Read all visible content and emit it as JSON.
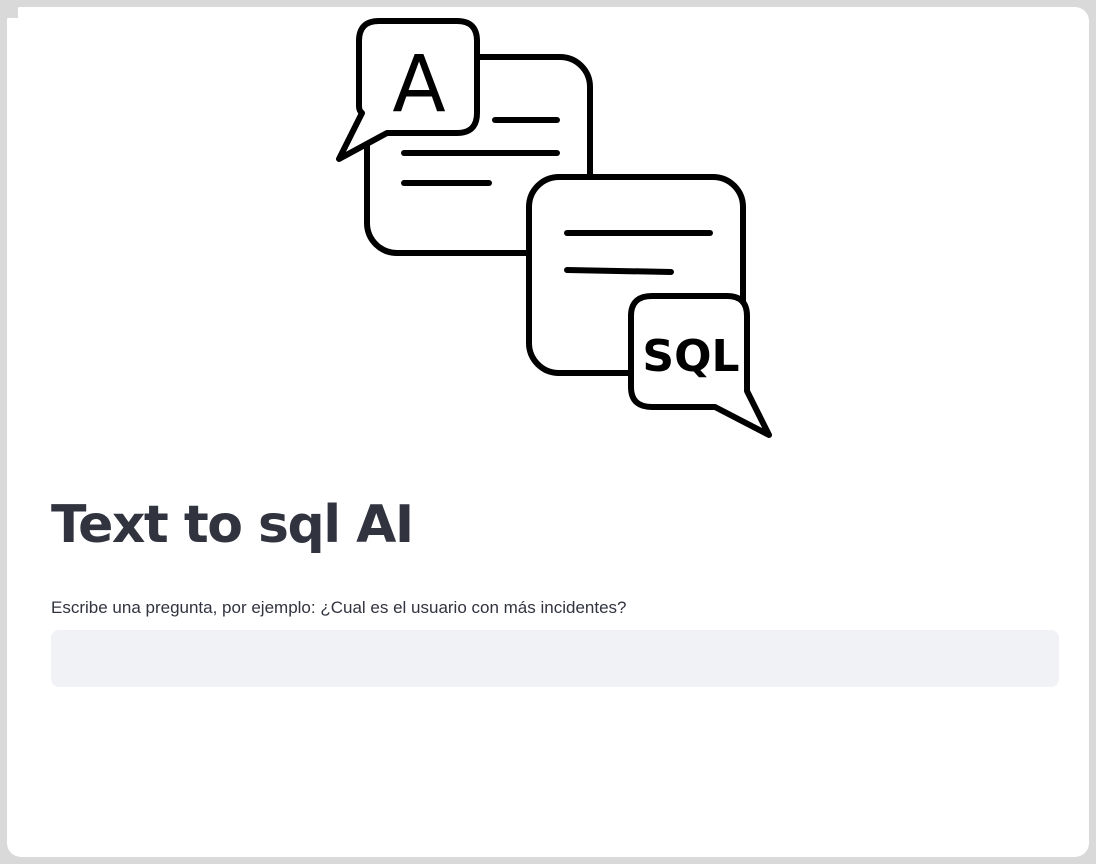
{
  "app": {
    "title": "Text to sql AI"
  },
  "hero": {
    "icon": "text-to-sql-chat-bubbles-illustration",
    "letter_glyph": "A",
    "sql_glyph": "SQL"
  },
  "question": {
    "label": "Escribe una pregunta, por ejemplo: ¿Cual es el usuario con más incidentes?",
    "value": "",
    "placeholder": ""
  },
  "colors": {
    "text": "#31333f",
    "input_background": "#f0f2f6",
    "page_background": "#ffffff",
    "outer_background": "#d9d9d9",
    "icon_stroke": "#000000"
  }
}
